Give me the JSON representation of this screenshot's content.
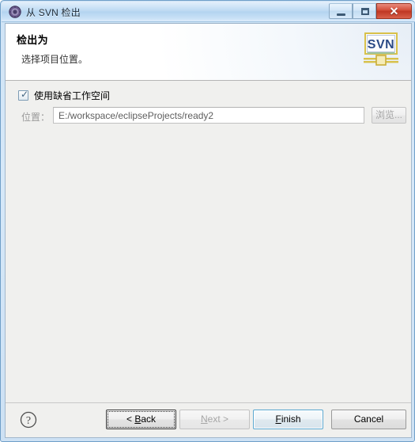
{
  "window": {
    "title": "从 SVN 检出",
    "icon": "svn-checkout-icon",
    "controls": {
      "minimize_label": "–",
      "maximize_label": "□",
      "close_label": "✕"
    }
  },
  "header": {
    "title": "检出为",
    "subtitle": "选择项目位置。",
    "logo_text": "SVN",
    "logo_name": "svn-logo"
  },
  "form": {
    "use_default_workspace": {
      "label": "使用缺省工作空间",
      "checked": true,
      "check_glyph": "✓"
    },
    "location": {
      "label": "位置：",
      "value": "E:/workspace/eclipseProjects/ready2",
      "placeholder": "E:/workspace",
      "enabled": false
    },
    "browse_button": {
      "label": "浏览...",
      "enabled": false
    }
  },
  "footer": {
    "help_label": "?",
    "buttons": {
      "back": {
        "prefix": "< ",
        "mnemonic": "B",
        "suffix": "ack",
        "enabled": true,
        "focused": true
      },
      "next": {
        "prefix": "",
        "mnemonic": "N",
        "suffix": "ext >",
        "enabled": false,
        "focused": false
      },
      "finish": {
        "prefix": "",
        "mnemonic": "F",
        "suffix": "inish",
        "enabled": true,
        "default": true
      },
      "cancel": {
        "prefix": "",
        "mnemonic": "",
        "suffix": "Cancel",
        "enabled": true,
        "focused": false
      }
    }
  },
  "colors": {
    "titlebar_accent": "#b3d4f0",
    "close_button": "#bf3723",
    "default_button_border": "#5ba8d0",
    "client_background": "#f0f0ee",
    "header_background": "#ffffff",
    "svn_blue": "#2b4a86",
    "svn_gold": "#d8c14a",
    "disabled_text": "#a6a6a6"
  }
}
